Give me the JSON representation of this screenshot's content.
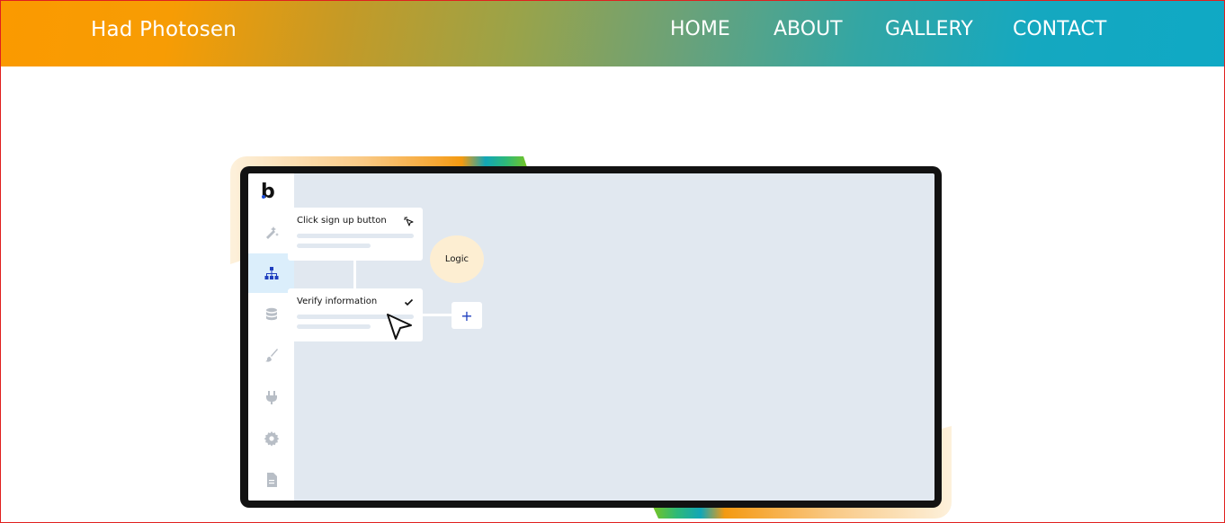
{
  "navbar": {
    "brand": "Had Photosen",
    "links": [
      {
        "label": "HOME"
      },
      {
        "label": "ABOUT"
      },
      {
        "label": "GALLERY"
      },
      {
        "label": "CONTACT"
      }
    ]
  },
  "hero_illustration": {
    "app_logo": "b",
    "sidebar_icons": [
      "design-tools-icon",
      "workflow-icon",
      "database-icon",
      "brush-icon",
      "plug-icon",
      "settings-icon",
      "document-icon"
    ],
    "active_sidebar_icon": "workflow-icon",
    "cards": {
      "click_signup": {
        "title": "Click sign up button",
        "icon": "cursor-click-icon"
      },
      "verify_info": {
        "title": "Verify information",
        "icon": "checkmark-icon"
      }
    },
    "logic_bubble": "Logic",
    "add_button": "+"
  },
  "colors": {
    "navbar_gradient_start": "#fb9a00",
    "navbar_gradient_end": "#0fa9c5",
    "canvas": "#e1e8f0",
    "frame": "#121212",
    "sidebar_active_bg": "#dbeefb",
    "logic_bubble_bg": "#fdeed2",
    "accent_blue": "#1f3fbf",
    "border": "#e0201f"
  }
}
